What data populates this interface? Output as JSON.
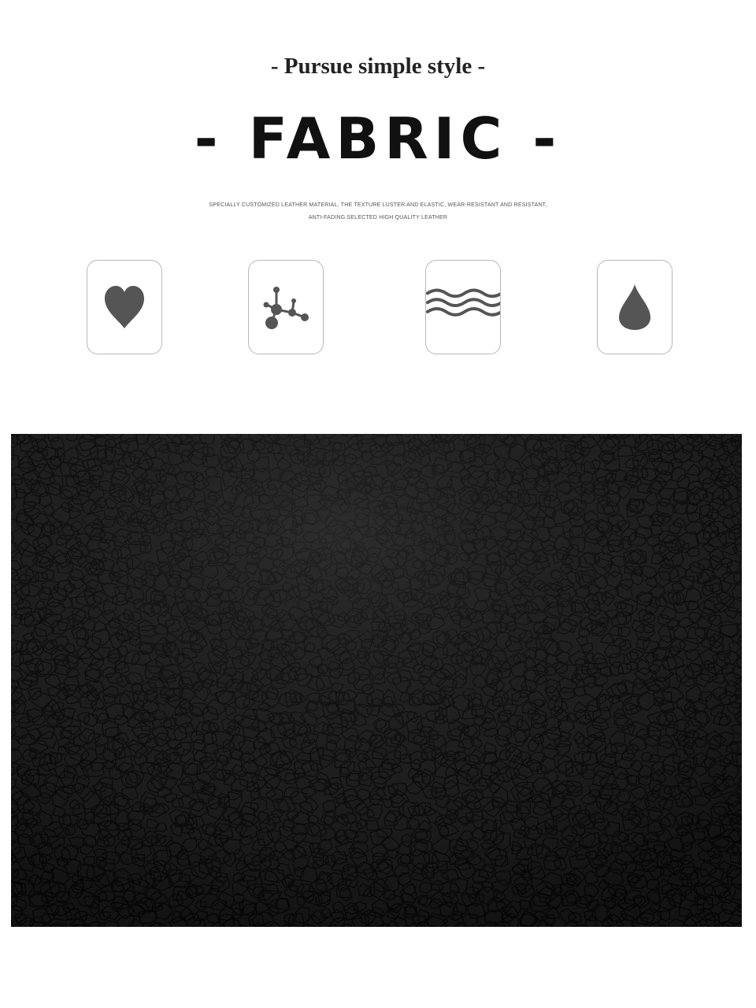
{
  "header": {
    "tagline": "- Pursue simple style -",
    "title": "- FABRIC -",
    "description_line1": "SPECIALLY CUSTOMIZED LEATHER MATERIAL, THE TEXTURE LUSTER AND ELASTIC, WEAR-RESISTANT AND RESISTANT,",
    "description_line2": "ANTI-FADING.SELECTED HIGH QUALITY LEATHER"
  },
  "features": [
    {
      "icon": "heart-icon"
    },
    {
      "icon": "molecule-icon"
    },
    {
      "icon": "waves-icon"
    },
    {
      "icon": "water-drop-icon"
    }
  ],
  "colors": {
    "icon_fill": "#555555",
    "leather_base": "#1d1d1d",
    "leather_grain": "#050505"
  }
}
